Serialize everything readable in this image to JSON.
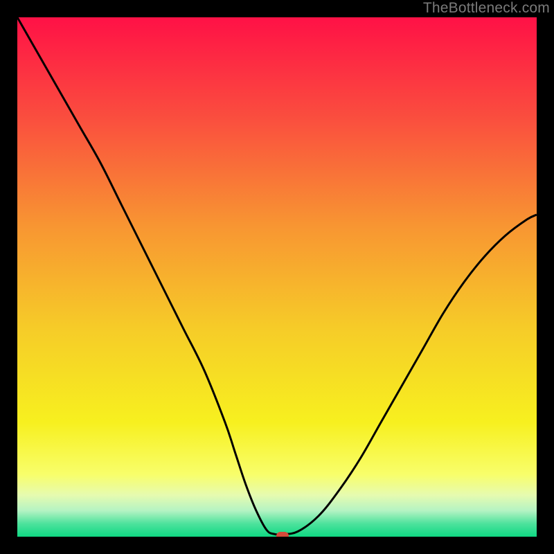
{
  "watermark": "TheBottleneck.com",
  "chart_data": {
    "type": "line",
    "title": "",
    "xlabel": "",
    "ylabel": "",
    "xlim": [
      0,
      100
    ],
    "ylim": [
      0,
      100
    ],
    "grid": false,
    "legend": false,
    "background_gradient": {
      "direction": "vertical",
      "stops": [
        {
          "pos": 0.0,
          "color": "#ff1146"
        },
        {
          "pos": 0.2,
          "color": "#fa503e"
        },
        {
          "pos": 0.4,
          "color": "#f89532"
        },
        {
          "pos": 0.6,
          "color": "#f6cc28"
        },
        {
          "pos": 0.78,
          "color": "#f7f01f"
        },
        {
          "pos": 0.88,
          "color": "#f8fe6a"
        },
        {
          "pos": 0.92,
          "color": "#e6fbb0"
        },
        {
          "pos": 0.95,
          "color": "#b4f3c3"
        },
        {
          "pos": 0.975,
          "color": "#4de29c"
        },
        {
          "pos": 1.0,
          "color": "#0fd883"
        }
      ]
    },
    "series": [
      {
        "name": "bottleneck-curve",
        "stroke": "#000000",
        "stroke_width": 3,
        "x": [
          0,
          4,
          8,
          12,
          16,
          20,
          24,
          28,
          32,
          36,
          40,
          42,
          44,
          46,
          48,
          49.5,
          51,
          54,
          58,
          62,
          66,
          70,
          74,
          78,
          82,
          86,
          90,
          94,
          98,
          100
        ],
        "y": [
          100,
          93,
          86,
          79,
          72,
          64,
          56,
          48,
          40,
          32,
          22,
          16,
          10,
          5,
          1.3,
          0.5,
          0.5,
          1.0,
          4,
          9,
          15,
          22,
          29,
          36,
          43,
          49,
          54,
          58,
          61,
          62
        ]
      }
    ],
    "marker": {
      "x": 51,
      "y": 0.2,
      "color": "#d44a3a"
    }
  }
}
